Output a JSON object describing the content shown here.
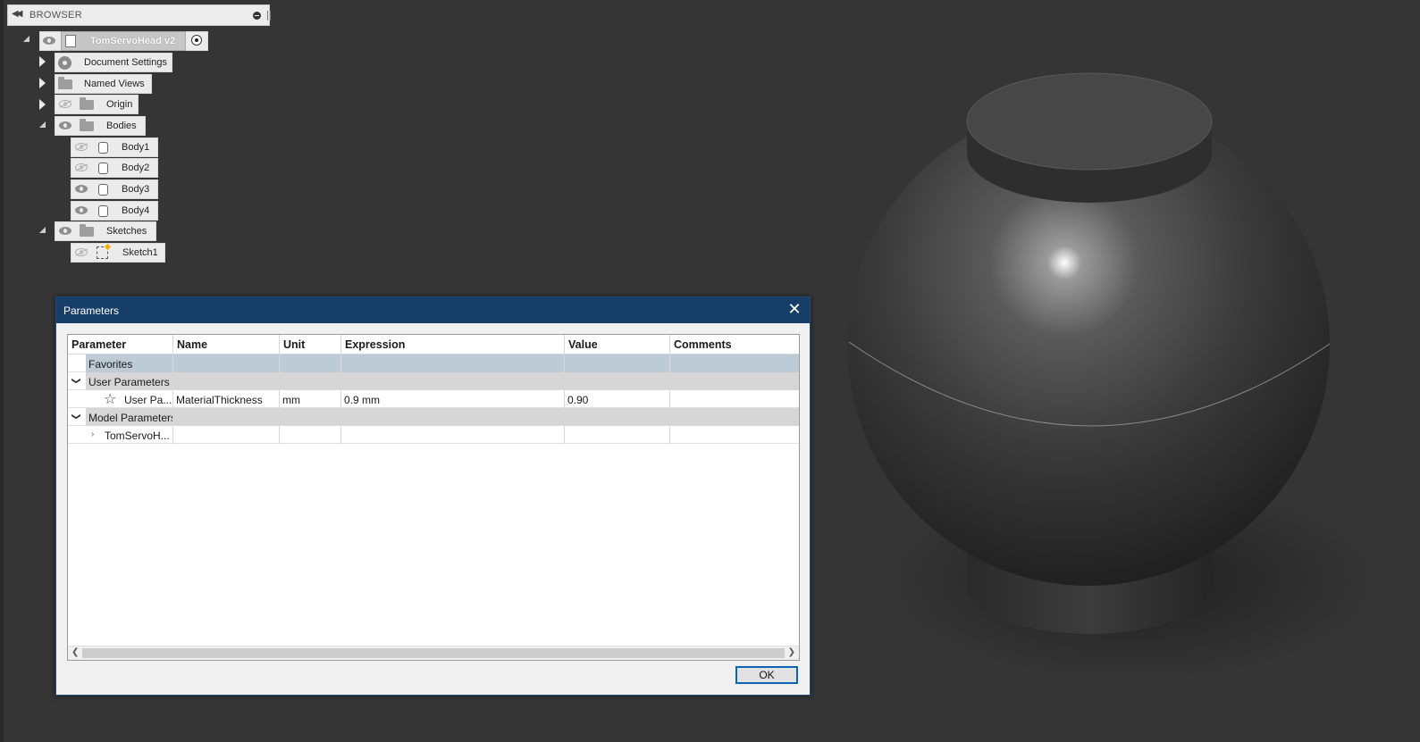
{
  "browser": {
    "title": "BROWSER",
    "root": {
      "label": "TomServoHead v2"
    },
    "nodes": [
      {
        "label": "Document Settings"
      },
      {
        "label": "Named Views"
      },
      {
        "label": "Origin"
      },
      {
        "label": "Bodies"
      },
      {
        "label": "Body1"
      },
      {
        "label": "Body2"
      },
      {
        "label": "Body3"
      },
      {
        "label": "Body4"
      },
      {
        "label": "Sketches"
      },
      {
        "label": "Sketch1"
      }
    ]
  },
  "parameters_dialog": {
    "title": "Parameters",
    "columns": [
      "Parameter",
      "Name",
      "Unit",
      "Expression",
      "Value",
      "Comments"
    ],
    "favorites_label": "Favorites",
    "user_parameters_label": "User Parameters",
    "user_row": {
      "parameter": "User Pa...",
      "name": "MaterialThickness",
      "unit": "mm",
      "expression": "0.9 mm",
      "value": "0.90",
      "comments": ""
    },
    "model_parameters_label": "Model Parameters",
    "model_row": {
      "parameter": "TomServoH..."
    },
    "ok_label": "OK"
  },
  "colors": {
    "viewport_bg": "#353535",
    "dialog_title_bg": "#163e68",
    "favorites_row": "#bccbd6",
    "group_row": "#d6d6d6",
    "ok_border": "#0a64b4"
  }
}
